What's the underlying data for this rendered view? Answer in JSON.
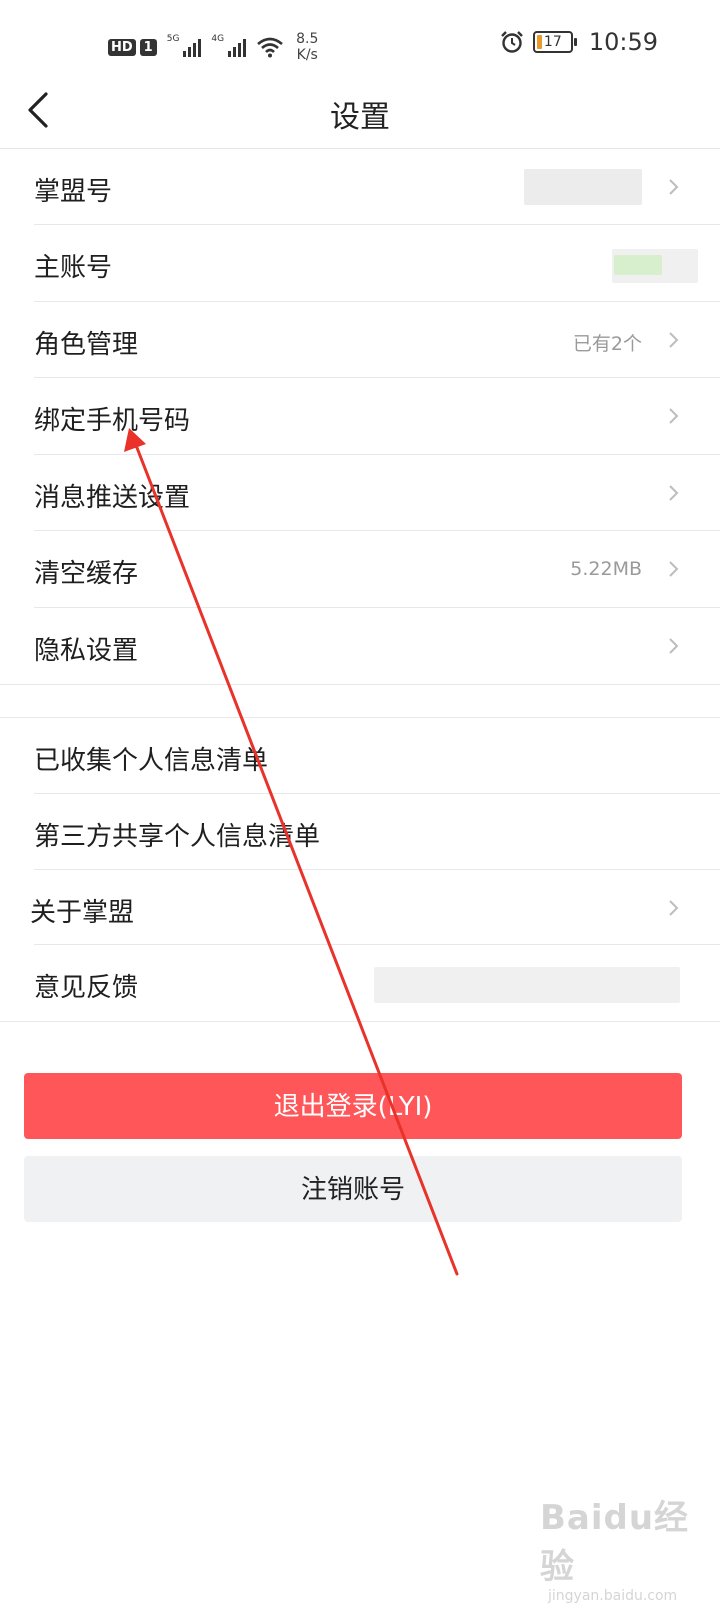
{
  "status_bar": {
    "hd": "HD",
    "sim": "1",
    "net1": "5G",
    "net2": "4G",
    "speed_value": "8.5",
    "speed_unit": "K/s",
    "battery": "17",
    "time": "10:59",
    "icons": [
      "signal-icon",
      "wifi-icon",
      "alarm-icon",
      "battery-icon"
    ]
  },
  "header": {
    "title": "设置",
    "back_icon": "chevron-left-icon"
  },
  "settings": {
    "group1": [
      {
        "label": "掌盟号",
        "value": ""
      },
      {
        "label": "主账号",
        "value": ""
      },
      {
        "label": "角色管理",
        "value": "已有2个"
      },
      {
        "label": "绑定手机号码",
        "value": ""
      },
      {
        "label": "消息推送设置",
        "value": ""
      },
      {
        "label": "清空缓存",
        "value": "5.22MB"
      },
      {
        "label": "隐私设置",
        "value": ""
      }
    ],
    "group2": [
      {
        "label": "已收集个人信息清单"
      },
      {
        "label": "第三方共享个人信息清单"
      },
      {
        "label": "关于掌盟"
      },
      {
        "label": "意见反馈"
      }
    ]
  },
  "buttons": {
    "logout": "退出登录(LYI)",
    "cancel_account": "注销账号"
  },
  "watermark": {
    "logo": "Baidu经验",
    "sub": "jingyan.baidu.com"
  },
  "colors": {
    "logout_bg": "#ff5759",
    "cancel_bg": "#f0f1f3",
    "annotation_arrow": "#e8322a"
  }
}
